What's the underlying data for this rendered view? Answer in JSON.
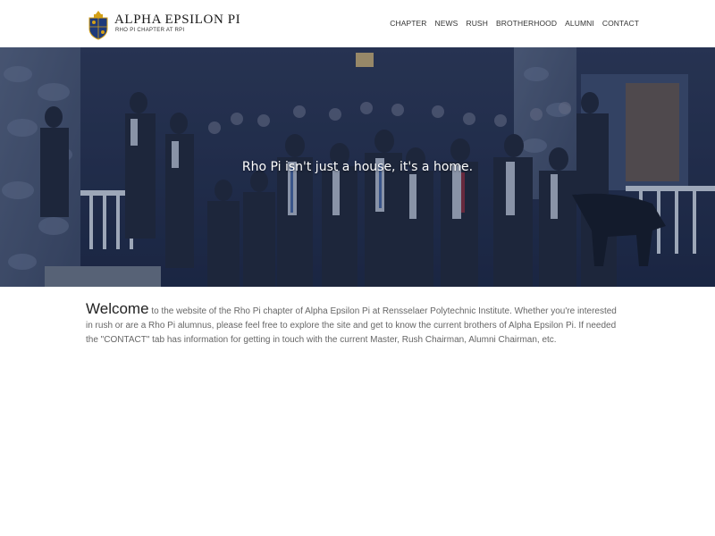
{
  "brand": {
    "title": "ALPHA EPSILON PI",
    "subtitle": "RHO PI CHAPTER AT RPI",
    "logo_icon": "crest-icon"
  },
  "nav": [
    {
      "label": "CHAPTER"
    },
    {
      "label": "NEWS"
    },
    {
      "label": "RUSH"
    },
    {
      "label": "BROTHERHOOD"
    },
    {
      "label": "ALUMNI"
    },
    {
      "label": "CONTACT"
    }
  ],
  "hero": {
    "tagline": "Rho Pi isn't just a house, it's a home.",
    "image_icon": "group-photo-icon"
  },
  "welcome": {
    "lead": "Welcome",
    "body": "to the website of the Rho Pi chapter of Alpha Epsilon Pi at Rensselaer Polytechnic Institute. Whether you're interested in rush or are a Rho Pi alumnus, please feel free to explore the site and get to know the current brothers of Alpha Epsilon Pi. If needed the \"CONTACT\" tab has information for getting in touch with the current Master, Rush Chairman, Alumni Chairman, etc."
  },
  "colors": {
    "hero_overlay": "#1b2a4a",
    "crest_blue": "#1f3a7a",
    "crest_gold": "#d4a017"
  }
}
